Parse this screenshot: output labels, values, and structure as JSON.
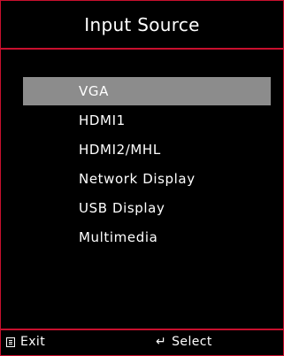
{
  "window": {
    "title": "Input Source"
  },
  "menu": {
    "items": [
      {
        "label": "VGA",
        "selected": true
      },
      {
        "label": "HDMI1",
        "selected": false
      },
      {
        "label": "HDMI2/MHL",
        "selected": false
      },
      {
        "label": "Network Display",
        "selected": false
      },
      {
        "label": "USB Display",
        "selected": false
      },
      {
        "label": "Multimedia",
        "selected": false
      }
    ]
  },
  "footer": {
    "exit_label": "Exit",
    "exit_icon": "menu-icon",
    "select_label": "Select",
    "select_icon": "enter-arrow-icon"
  },
  "colors": {
    "accent": "#c8102e",
    "highlight": "#8c8c8c",
    "background": "#000000",
    "text": "#ffffff"
  }
}
